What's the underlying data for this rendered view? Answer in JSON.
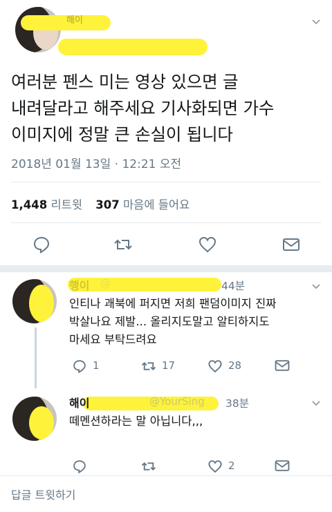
{
  "main_tweet": {
    "author_name": "해이",
    "handle": "@",
    "text_lines": [
      "여러분 펜스 미는 영상 있으면 글",
      "내려달라고 해주세요 기사화되면 가수",
      "이미지에 정말 큰 손실이 됩니다"
    ],
    "timestamp": "2018년 01월 13일 · 12:21 오전",
    "retweet_count": "1,448",
    "retweet_label": "리트윗",
    "like_count": "307",
    "like_label": "마음에 들어요",
    "icons": [
      "reply-icon",
      "retweet-icon",
      "heart-icon",
      "dm-icon"
    ]
  },
  "replies": [
    {
      "name": "행이",
      "handle": "@",
      "time": "44분",
      "text_lines": [
        "인티나 괘북에 퍼지면 저희 팬덤이미지 진짜",
        "박살나요 제발... 올리지도말고 알티하지도",
        "마세요 부탁드려요"
      ],
      "reply_count": "1",
      "retweet_count": "17",
      "like_count": "28"
    },
    {
      "name": "해이",
      "handle": "@YourSing",
      "time": "38분",
      "text_lines": [
        "떼멘션하라는 말 아닙니다,,,"
      ],
      "reply_count": "",
      "retweet_count": "",
      "like_count": "2"
    }
  ],
  "compose": {
    "placeholder": "답글 트윗하기"
  },
  "colors": {
    "text": "#14171a",
    "secondary": "#657786",
    "divider": "#e1e8ed",
    "highlight": "#fff23a"
  }
}
